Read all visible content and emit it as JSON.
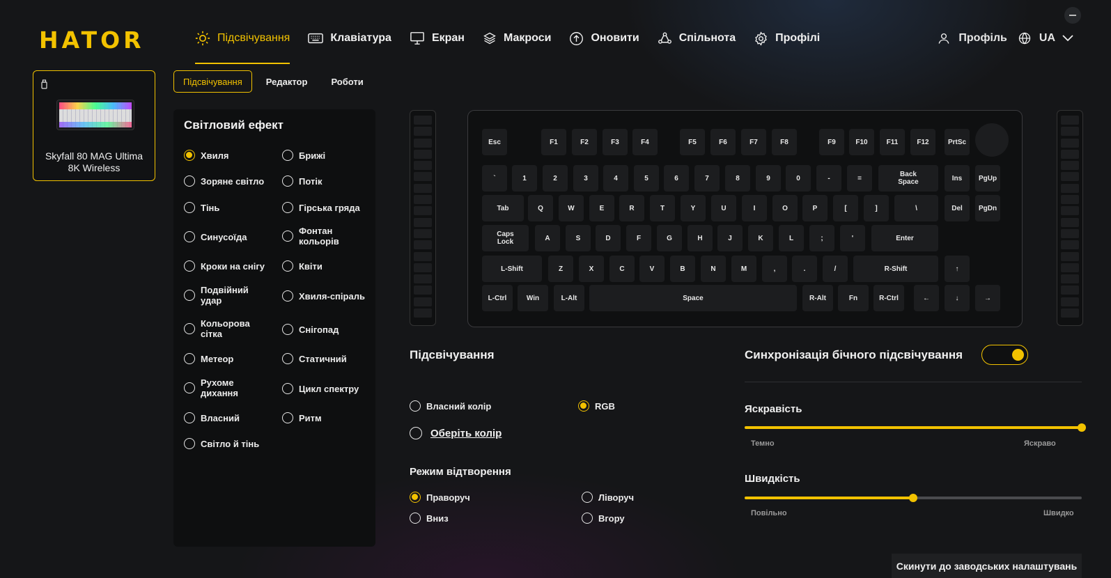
{
  "brand": {
    "logo": "HATOR",
    "accent": "#f2c200"
  },
  "nav": {
    "items": [
      {
        "label": "Підсвічування",
        "icon": "sun-icon",
        "active": true
      },
      {
        "label": "Клавіатура",
        "icon": "keyboard-icon"
      },
      {
        "label": "Екран",
        "icon": "monitor-icon"
      },
      {
        "label": "Макроси",
        "icon": "layers-icon"
      },
      {
        "label": "Оновити",
        "icon": "upload-icon"
      },
      {
        "label": "Спільнота",
        "icon": "community-icon"
      },
      {
        "label": "Профілі",
        "icon": "gear-icon"
      }
    ],
    "profile_label": "Профіль",
    "language": "UA"
  },
  "device": {
    "name": "Skyfall 80 MAG Ultima\n8K Wireless",
    "icon": "usb-icon"
  },
  "subtabs": [
    "Підсвічування",
    "Редактор",
    "Роботи"
  ],
  "effects": {
    "title": "Світловий ефект",
    "left": [
      "Хвиля",
      "Зоряне світло",
      "Тінь",
      "Синусоїда",
      "Кроки на снігу",
      "Подвійний\nудар",
      "Кольорова\nсітка",
      "Метеор",
      "Рухоме\nдихання",
      "Власний",
      "Світло й тінь"
    ],
    "right": [
      "Брижі",
      "Потік",
      "Гірська гряда",
      "Фонтан\nкольорів",
      "Квіти",
      "Хвиля-спіраль",
      "Снігопад",
      "Статичний",
      "Цикл спектру",
      "Ритм"
    ],
    "selected": "Хвиля"
  },
  "keyboard": {
    "rows": [
      [
        "Esc",
        "F1",
        "F2",
        "F3",
        "F4",
        "F5",
        "F6",
        "F7",
        "F8",
        "F9",
        "F10",
        "F11",
        "F12",
        "PrtSc"
      ],
      [
        "`",
        "1",
        "2",
        "3",
        "4",
        "5",
        "6",
        "7",
        "8",
        "9",
        "0",
        "-",
        "=",
        "Back\nSpace",
        "Ins",
        "PgUp"
      ],
      [
        "Tab",
        "Q",
        "W",
        "E",
        "R",
        "T",
        "Y",
        "U",
        "I",
        "O",
        "P",
        "[",
        "]",
        "\\",
        "Del",
        "PgDn"
      ],
      [
        "Caps\nLock",
        "A",
        "S",
        "D",
        "F",
        "G",
        "H",
        "J",
        "K",
        "L",
        ";",
        "'",
        "Enter"
      ],
      [
        "L-Shift",
        "Z",
        "X",
        "C",
        "V",
        "B",
        "N",
        "M",
        ",",
        ".",
        "/",
        "R-Shift",
        "↑"
      ],
      [
        "L-Ctrl",
        "Win",
        "L-Alt",
        "Space",
        "R-Alt",
        "Fn",
        "R-Ctrl",
        "←",
        "↓",
        "→"
      ]
    ]
  },
  "lighting": {
    "title": "Підсвічування",
    "color_options": [
      {
        "label": "Власний колір",
        "selected": false
      },
      {
        "label": "RGB",
        "selected": true
      }
    ],
    "pick_color": "Оберіть колір"
  },
  "playback": {
    "title": "Режим відтворення",
    "options": [
      {
        "label": "Праворуч",
        "selected": true
      },
      {
        "label": "Ліворуч",
        "selected": false
      },
      {
        "label": "Вниз",
        "selected": false
      },
      {
        "label": "Вгору",
        "selected": false
      }
    ]
  },
  "sync": {
    "label": "Синхронізація бічного підсвічування",
    "on": true
  },
  "brightness": {
    "label": "Яскравість",
    "value": 100,
    "min_label": "Темно",
    "max_label": "Яскраво"
  },
  "speed": {
    "label": "Швидкість",
    "value": 50,
    "min_label": "Повільно",
    "max_label": "Швидко"
  },
  "reset_label": "Скинути до заводських налаштувань"
}
